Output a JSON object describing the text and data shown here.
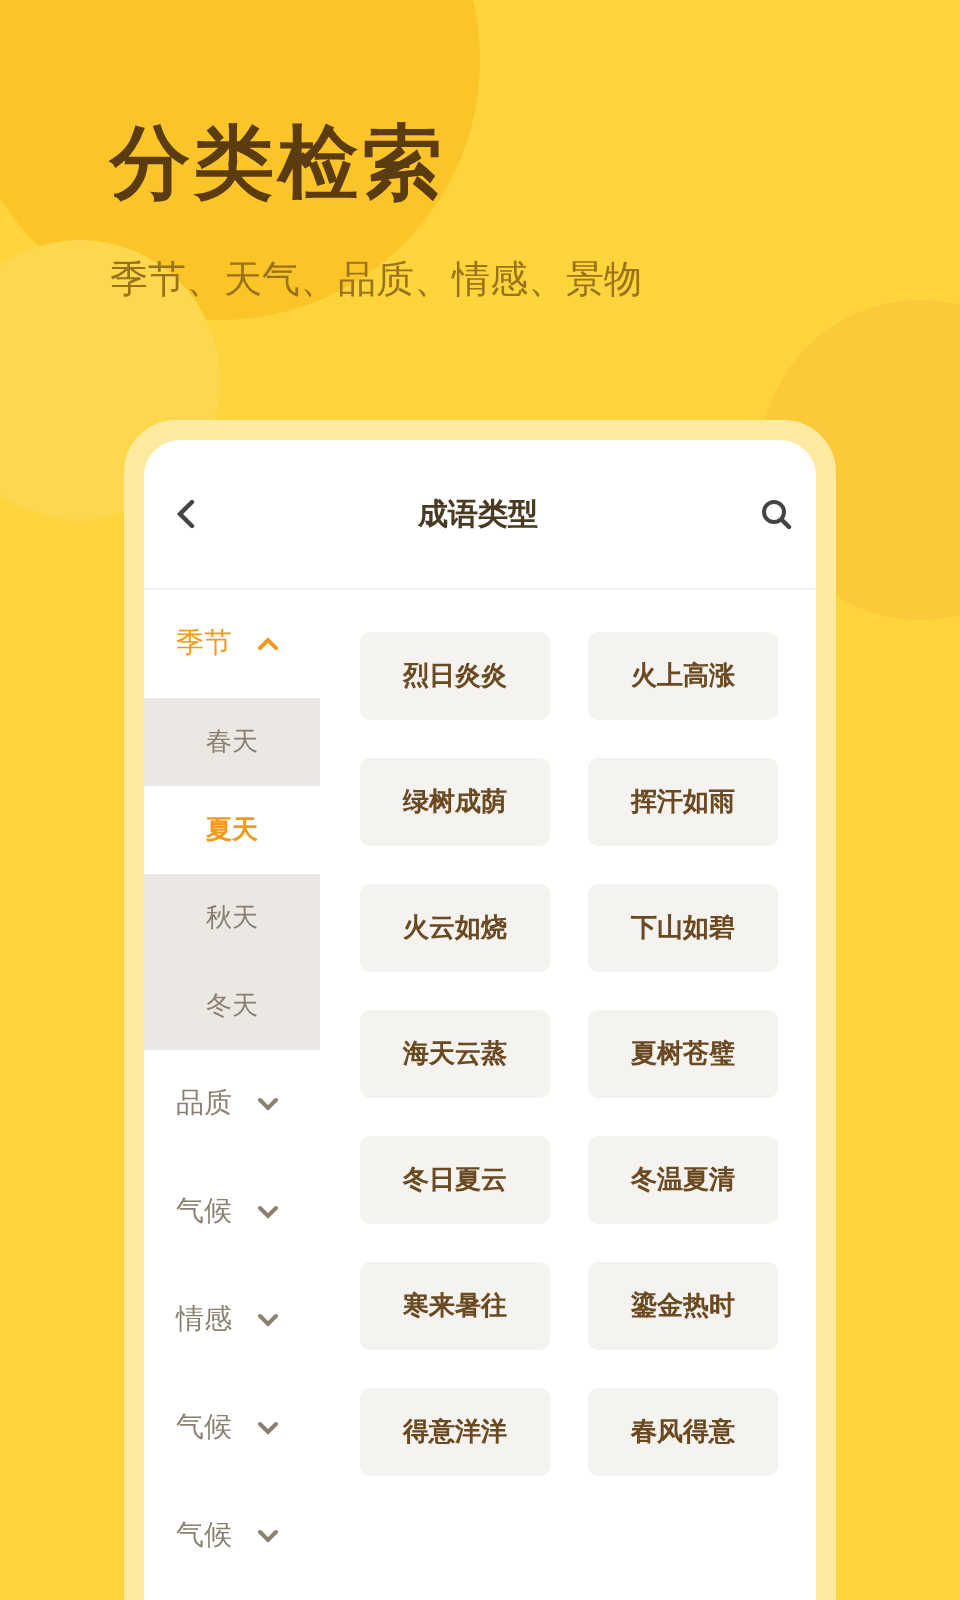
{
  "hero": {
    "title": "分类检索",
    "subtitle": "季节、天气、品质、情感、景物"
  },
  "header": {
    "title": "成语类型"
  },
  "categories": [
    {
      "label": "季节",
      "expanded": true,
      "children": [
        {
          "label": "春天",
          "selected": false
        },
        {
          "label": "夏天",
          "selected": true
        },
        {
          "label": "秋天",
          "selected": false
        },
        {
          "label": "冬天",
          "selected": false
        }
      ]
    },
    {
      "label": "品质",
      "expanded": false
    },
    {
      "label": "气候",
      "expanded": false
    },
    {
      "label": "情感",
      "expanded": false
    },
    {
      "label": "气候",
      "expanded": false
    },
    {
      "label": "气候",
      "expanded": false
    }
  ],
  "idioms": [
    "烈日炎炎",
    "火上高涨",
    "绿树成荫",
    "挥汗如雨",
    "火云如烧",
    "下山如碧",
    "海天云蒸",
    "夏树苍璧",
    "冬日夏云",
    "冬温夏清",
    "寒来暑往",
    "鎏金热时",
    "得意洋洋",
    "春风得意"
  ]
}
